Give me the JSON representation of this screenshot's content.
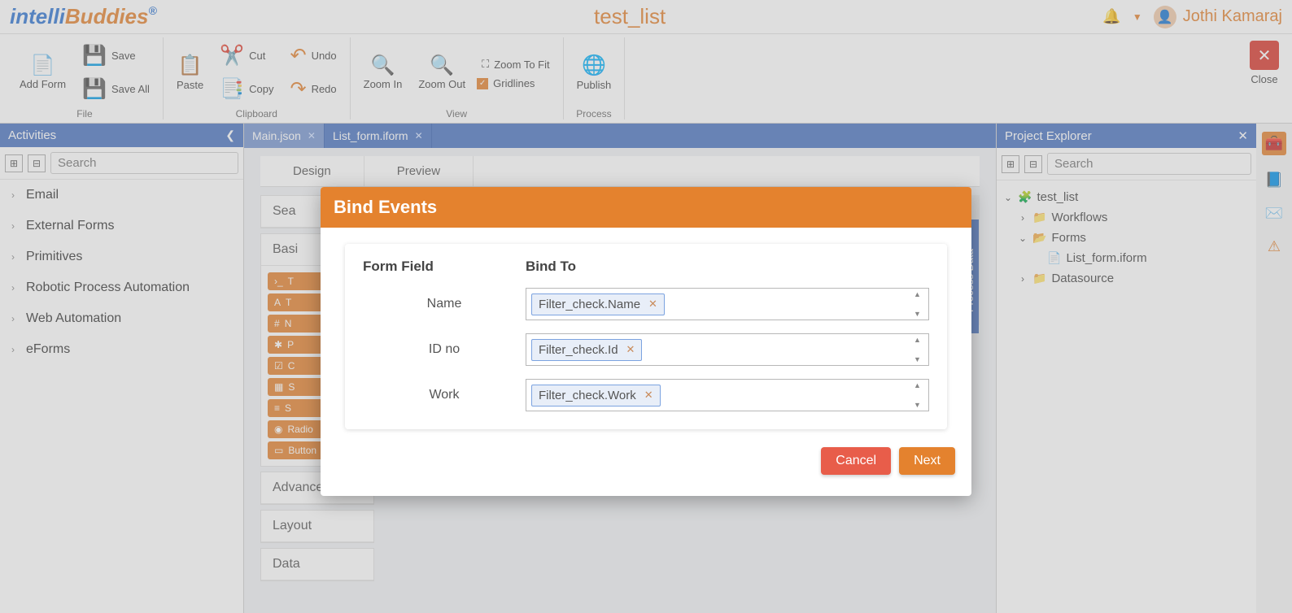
{
  "app": {
    "logo_a": "intelli",
    "logo_b": "Buddies",
    "logo_sup": "®",
    "title": "test_list",
    "user": "Jothi Kamaraj"
  },
  "ribbon": {
    "add_form": "Add Form",
    "save": "Save",
    "save_all": "Save All",
    "paste": "Paste",
    "cut": "Cut",
    "copy": "Copy",
    "undo": "Undo",
    "redo": "Redo",
    "zoom_in": "Zoom In",
    "zoom_out": "Zoom Out",
    "zoom_fit": "Zoom To Fit",
    "gridlines": "Gridlines",
    "publish": "Publish",
    "close": "Close",
    "g_file": "File",
    "g_clipboard": "Clipboard",
    "g_view": "View",
    "g_process": "Process"
  },
  "activities": {
    "title": "Activities",
    "search_ph": "Search",
    "items": [
      "Email",
      "External Forms",
      "Primitives",
      "Robotic Process Automation",
      "Web Automation",
      "eForms"
    ]
  },
  "tabs": {
    "main": "Main.json",
    "form": "List_form.iform"
  },
  "subtabs": {
    "design": "Design",
    "preview": "Preview"
  },
  "designer": {
    "search": "Sea",
    "basic": "Basi",
    "chips": [
      "T",
      "T",
      "N",
      "P",
      "C",
      "S",
      "S",
      "Radio",
      "Button"
    ],
    "advanced": "Advanced",
    "layout": "Layout",
    "data": "Data"
  },
  "process_tab": "Process Data",
  "explorer": {
    "title": "Project Explorer",
    "search_ph": "Search",
    "root": "test_list",
    "workflows": "Workflows",
    "forms": "Forms",
    "form_file": "List_form.iform",
    "datasource": "Datasource"
  },
  "dialog": {
    "title": "Bind Events",
    "col_field": "Form Field",
    "col_bind": "Bind To",
    "rows": [
      {
        "label": "Name",
        "token": "Filter_check.Name"
      },
      {
        "label": "ID no",
        "token": "Filter_check.Id"
      },
      {
        "label": "Work",
        "token": "Filter_check.Work"
      }
    ],
    "cancel": "Cancel",
    "next": "Next"
  }
}
